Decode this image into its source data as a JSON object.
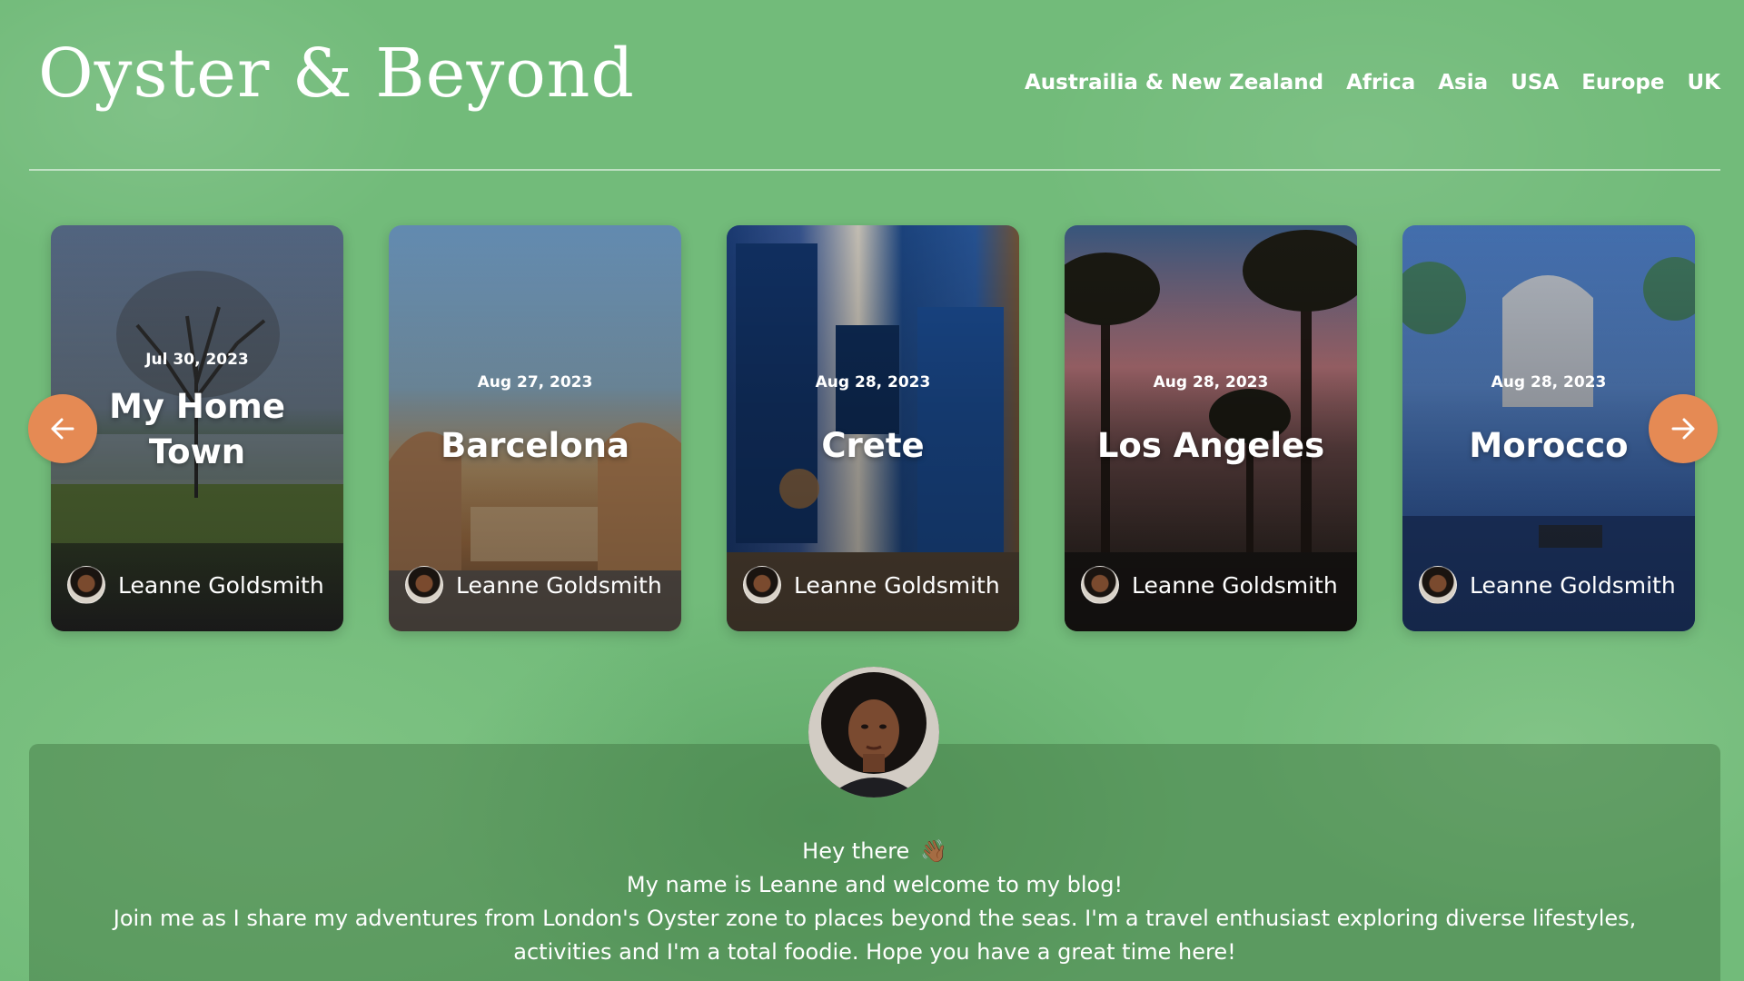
{
  "site": {
    "logo": "Oyster & Beyond"
  },
  "nav": {
    "items": [
      {
        "label": "Austrailia & New Zealand"
      },
      {
        "label": "Africa"
      },
      {
        "label": "Asia"
      },
      {
        "label": "USA"
      },
      {
        "label": "Europe"
      },
      {
        "label": "UK"
      }
    ]
  },
  "carousel": {
    "cards": [
      {
        "date": "Jul 30, 2023",
        "title_line1": "My Home",
        "title_line2": "Town",
        "author": "Leanne Goldsmith"
      },
      {
        "date": "Aug 27, 2023",
        "title_line1": "Barcelona",
        "title_line2": "",
        "author": "Leanne Goldsmith"
      },
      {
        "date": "Aug 28, 2023",
        "title_line1": "Crete",
        "title_line2": "",
        "author": "Leanne Goldsmith"
      },
      {
        "date": "Aug 28, 2023",
        "title_line1": "Los Angeles",
        "title_line2": "",
        "author": "Leanne Goldsmith"
      },
      {
        "date": "Aug 28, 2023",
        "title_line1": "Morocco",
        "title_line2": "",
        "author": "Leanne Goldsmith"
      }
    ],
    "prev_icon": "arrow-left-icon",
    "next_icon": "arrow-right-icon",
    "arrow_color": "#e58a54"
  },
  "about": {
    "greeting": "Hey there",
    "greeting_emoji": "👋🏾",
    "line2": "My name is Leanne and welcome to my blog!",
    "line3": "Join me as I share my adventures from London's Oyster zone to places beyond the seas. I'm a travel enthusiast exploring diverse lifestyles,",
    "line4": "activities and I'm a total foodie. Hope you have a great time here!"
  },
  "colors": {
    "background": "#72bb7a",
    "accent": "#e58a54",
    "text": "#ffffff"
  }
}
